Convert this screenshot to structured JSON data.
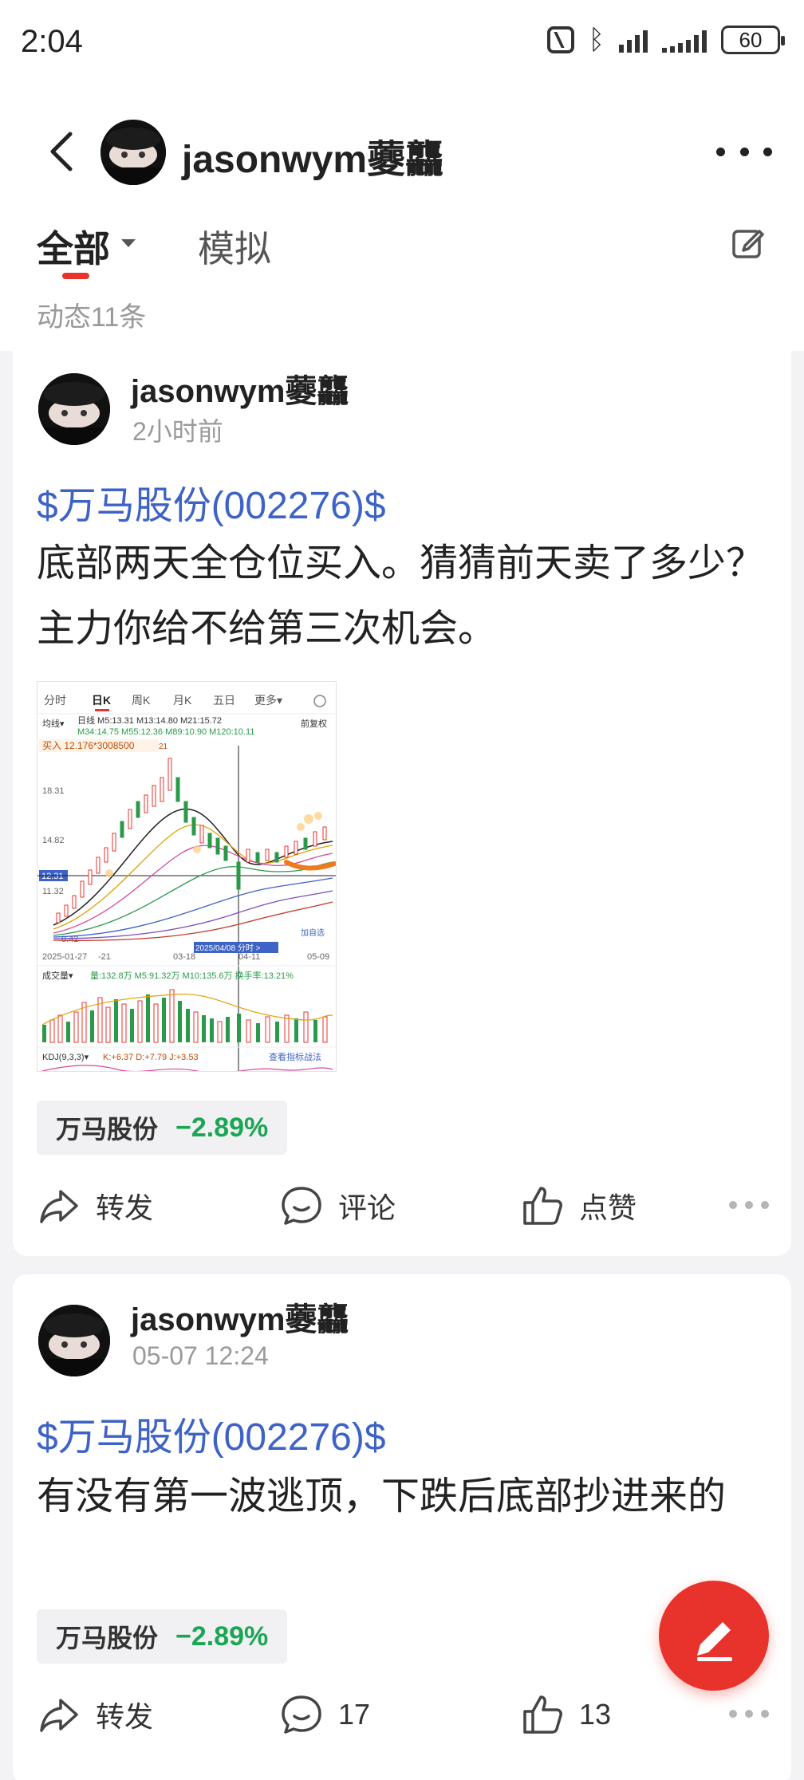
{
  "status_bar": {
    "time": "2:04",
    "battery": "60"
  },
  "header": {
    "username": "jasonwym虁龘"
  },
  "tabs": {
    "all_label": "全部",
    "sim_label": "模拟"
  },
  "feed": {
    "count_label": "动态11条"
  },
  "posts": [
    {
      "author": "jasonwym虁龘",
      "time": "2小时前",
      "stock_tag": "$万马股份(002276)$",
      "text": "底部两天全仓位买入。猜猜前天卖了多少？主力你给不给第三次机会。",
      "quote": {
        "name": "万马股份",
        "change": "−2.89%"
      },
      "actions": {
        "repost": "转发",
        "comment": "评论",
        "like": "点赞"
      },
      "chart_image": {
        "tabs": [
          "分时",
          "日K",
          "周K",
          "月K",
          "五日",
          "更多▾"
        ],
        "ma_label": "均线▾",
        "ma_line1": "日线  M5:13.31  M13:14.80  M21:15.72",
        "ma_line2": "M34:14.75  M55:12.36  M89:10.90  M120:10.11",
        "adjust": "前复权",
        "buy_note": "买入 12.176*3008500",
        "buy_note_suffix": "21",
        "y_labels": [
          "18.31",
          "14.82",
          "12.31",
          "11.32",
          "8.42"
        ],
        "x_labels": [
          "2025-01-27",
          "-21",
          "03-18",
          "04-11",
          "05-09"
        ],
        "cursor_date": "2025/04/08  分时 >",
        "add_watch": "加自选",
        "vol_label": "成交量▾",
        "vol_values": "量:132.8万  M5:91.32万  M10:135.6万  换手率:13.21%",
        "kdj_label": "KDJ(9,3,3)▾",
        "kdj_values": "K:+6.37  D:+7.79  J:+3.53",
        "kdj_link": "查看指标战法"
      }
    },
    {
      "author": "jasonwym虁龘",
      "time": "05-07 12:24",
      "stock_tag": "$万马股份(002276)$",
      "text": "有没有第一波逃顶，下跌后底部抄进来的",
      "quote": {
        "name": "万马股份",
        "change": "−2.89%"
      },
      "actions": {
        "repost": "转发",
        "comment": "17",
        "like": "13"
      }
    }
  ],
  "colors": {
    "accent_red": "#e8332c",
    "link_blue": "#3e63c6",
    "down_green": "#1aa653"
  }
}
